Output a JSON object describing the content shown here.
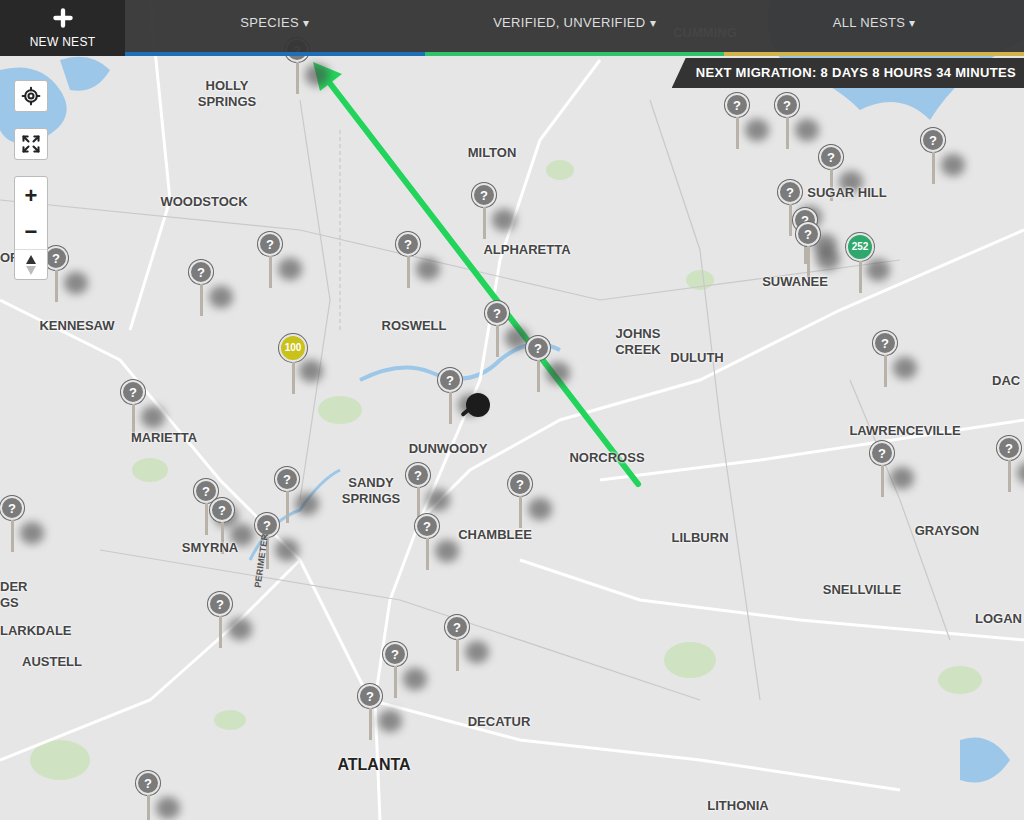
{
  "toolbar": {
    "new_nest": "NEW NEST",
    "filters": [
      {
        "label": "SPECIES",
        "caret": "▾",
        "color": "#1f6fb8"
      },
      {
        "label": "VERIFIED, UNVERIFIED",
        "caret": "▾",
        "color": "#2fc46a"
      },
      {
        "label": "ALL NESTS",
        "caret": "▾",
        "color": "#d2b44a"
      }
    ]
  },
  "migration": "NEXT MIGRATION: 8 DAYS 8 HOURS 34 MINUTES",
  "controls": {
    "zoom_in": "+",
    "zoom_out": "−"
  },
  "places": [
    {
      "name": "HOLLY SPRINGS"
    },
    {
      "name": "CUMMING"
    },
    {
      "name": "MILTON"
    },
    {
      "name": "WOODSTOCK"
    },
    {
      "name": "ALPHARETTA"
    },
    {
      "name": "SUGAR HILL"
    },
    {
      "name": "SUWANEE"
    },
    {
      "name": "KENNESAW"
    },
    {
      "name": "ROSWELL"
    },
    {
      "name": "JOHNS CREEK"
    },
    {
      "name": "DULUTH"
    },
    {
      "name": "MARIETTA"
    },
    {
      "name": "DUNWOODY"
    },
    {
      "name": "NORCROSS"
    },
    {
      "name": "LAWRENCEVILLE"
    },
    {
      "name": "DAC"
    },
    {
      "name": "SANDY SPRINGS"
    },
    {
      "name": "CHAMBLEE"
    },
    {
      "name": "SMYRNA"
    },
    {
      "name": "LILBURN"
    },
    {
      "name": "GRAYSON"
    },
    {
      "name": "SNELLVILLE"
    },
    {
      "name": "DER GS"
    },
    {
      "name": "LARKDALE"
    },
    {
      "name": "AUSTELL"
    },
    {
      "name": "DECATUR"
    },
    {
      "name": "ATLANTA"
    },
    {
      "name": "LOGAN"
    },
    {
      "name": "LITHONIA"
    },
    {
      "name": "OR"
    },
    {
      "name": "PERIMETER"
    }
  ],
  "pins": [
    {
      "kind": "unknown",
      "label": "?",
      "color": "#7b7b7b"
    },
    {
      "kind": "unknown",
      "label": "?",
      "color": "#7b7b7b"
    },
    {
      "kind": "unknown",
      "label": "?",
      "color": "#7b7b7b"
    },
    {
      "kind": "unknown",
      "label": "?",
      "color": "#7b7b7b"
    },
    {
      "kind": "unknown",
      "label": "?",
      "color": "#7b7b7b"
    },
    {
      "kind": "unknown",
      "label": "?",
      "color": "#7b7b7b"
    },
    {
      "kind": "unknown",
      "label": "?",
      "color": "#7b7b7b"
    },
    {
      "kind": "unknown",
      "label": "?",
      "color": "#7b7b7b"
    },
    {
      "kind": "count",
      "label": "252",
      "color": "#2fa86e"
    },
    {
      "kind": "unknown",
      "label": "?",
      "color": "#7b7b7b"
    },
    {
      "kind": "unknown",
      "label": "?",
      "color": "#7b7b7b"
    },
    {
      "kind": "unknown",
      "label": "?",
      "color": "#7b7b7b"
    },
    {
      "kind": "unknown",
      "label": "?",
      "color": "#7b7b7b"
    },
    {
      "kind": "unknown",
      "label": "?",
      "color": "#7b7b7b"
    },
    {
      "kind": "unknown",
      "label": "?",
      "color": "#7b7b7b"
    },
    {
      "kind": "unknown",
      "label": "?",
      "color": "#7b7b7b"
    },
    {
      "kind": "count",
      "label": "100",
      "color": "#c9c21b"
    },
    {
      "kind": "unknown",
      "label": "?",
      "color": "#7b7b7b"
    },
    {
      "kind": "unknown",
      "label": "?",
      "color": "#7b7b7b"
    },
    {
      "kind": "marker",
      "color": "#1c1c1c"
    },
    {
      "kind": "unknown",
      "label": "?",
      "color": "#7b7b7b"
    },
    {
      "kind": "unknown",
      "label": "?",
      "color": "#7b7b7b"
    },
    {
      "kind": "unknown",
      "label": "?",
      "color": "#7b7b7b"
    },
    {
      "kind": "unknown",
      "label": "?",
      "color": "#7b7b7b"
    },
    {
      "kind": "unknown",
      "label": "?",
      "color": "#7b7b7b"
    },
    {
      "kind": "unknown",
      "label": "?",
      "color": "#7b7b7b"
    },
    {
      "kind": "unknown",
      "label": "?",
      "color": "#7b7b7b"
    },
    {
      "kind": "unknown",
      "label": "?",
      "color": "#7b7b7b"
    },
    {
      "kind": "unknown",
      "label": "?",
      "color": "#7b7b7b"
    },
    {
      "kind": "unknown",
      "label": "?",
      "color": "#7b7b7b"
    },
    {
      "kind": "unknown",
      "label": "?",
      "color": "#7b7b7b"
    },
    {
      "kind": "unknown",
      "label": "?",
      "color": "#7b7b7b"
    },
    {
      "kind": "unknown",
      "label": "?",
      "color": "#7b7b7b"
    },
    {
      "kind": "unknown",
      "label": "?",
      "color": "#7b7b7b"
    },
    {
      "kind": "unknown",
      "label": "?",
      "color": "#7b7b7b"
    },
    {
      "kind": "unknown",
      "label": "?",
      "color": "#7b7b7b"
    }
  ]
}
